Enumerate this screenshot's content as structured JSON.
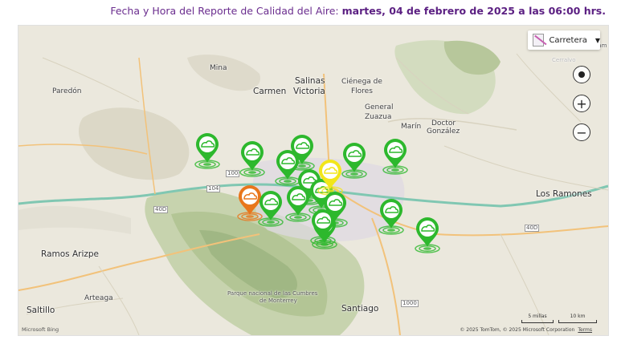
{
  "header": {
    "prefix": "Fecha y Hora del Reporte de Calidad del Aire:",
    "datetime": "martes, 04 de febrero de 2025 a las 06:00 hrs."
  },
  "map_style": {
    "label": "Carretera"
  },
  "places": [
    {
      "id": "mina",
      "text": "Mina"
    },
    {
      "id": "paredon",
      "text": "Paredón"
    },
    {
      "id": "carmen",
      "text": "Carmen"
    },
    {
      "id": "salinas",
      "text": "Salinas"
    },
    {
      "id": "victoria",
      "text": "Victoria"
    },
    {
      "id": "cienega",
      "text": "Ciénega de"
    },
    {
      "id": "flores",
      "text": "Flores"
    },
    {
      "id": "general",
      "text": "General"
    },
    {
      "id": "zuazua",
      "text": "Zuazua"
    },
    {
      "id": "marin",
      "text": "Marín"
    },
    {
      "id": "doctor",
      "text": "Doctor"
    },
    {
      "id": "gonzalez",
      "text": "González"
    },
    {
      "id": "ramones",
      "text": "Los Ramones"
    },
    {
      "id": "ramos",
      "text": "Ramos Arizpe"
    },
    {
      "id": "saltillo",
      "text": "Saltillo"
    },
    {
      "id": "arteaga",
      "text": "Arteaga"
    },
    {
      "id": "santiago",
      "text": "Santiago"
    },
    {
      "id": "parque1",
      "text": "Parque nacional de las Cumbres"
    },
    {
      "id": "parque2",
      "text": "de Monterrey"
    },
    {
      "id": "cerralvo",
      "text": "Cerralvo"
    },
    {
      "id": "ocampo",
      "text": "Ocam"
    }
  ],
  "highways": [
    {
      "id": "h100",
      "text": "100"
    },
    {
      "id": "h104",
      "text": "104"
    },
    {
      "id": "h40d",
      "text": "40D"
    },
    {
      "id": "h40d2",
      "text": "40D"
    },
    {
      "id": "h1000",
      "text": "1000"
    }
  ],
  "stations": [
    {
      "id": "s1",
      "status": "good",
      "color": "#2db82d"
    },
    {
      "id": "s2",
      "status": "good",
      "color": "#2db82d"
    },
    {
      "id": "s3",
      "status": "good",
      "color": "#2db82d"
    },
    {
      "id": "s4",
      "status": "good",
      "color": "#2db82d"
    },
    {
      "id": "s5",
      "status": "good",
      "color": "#2db82d"
    },
    {
      "id": "s6",
      "status": "good",
      "color": "#2db82d"
    },
    {
      "id": "s7",
      "status": "good",
      "color": "#2db82d"
    },
    {
      "id": "s8",
      "status": "moderate",
      "color": "#f2e61a"
    },
    {
      "id": "s9",
      "status": "good",
      "color": "#2db82d"
    },
    {
      "id": "s10",
      "status": "bad",
      "color": "#e8761c"
    },
    {
      "id": "s11",
      "status": "good",
      "color": "#2db82d"
    },
    {
      "id": "s12",
      "status": "good",
      "color": "#2db82d"
    },
    {
      "id": "s13",
      "status": "good",
      "color": "#2db82d"
    },
    {
      "id": "s14",
      "status": "good",
      "color": "#2db82d"
    },
    {
      "id": "s15",
      "status": "good",
      "color": "#2db82d"
    },
    {
      "id": "s16",
      "status": "good",
      "color": "#2db82d"
    },
    {
      "id": "s17",
      "status": "good",
      "color": "#2db82d"
    }
  ],
  "scale": {
    "miles": "5 millas",
    "km": "10 km"
  },
  "attribution": {
    "copyright": "© 2025 TomTom, © 2025 Microsoft Corporation",
    "terms": "Terms",
    "logo": "Microsoft Bing"
  }
}
